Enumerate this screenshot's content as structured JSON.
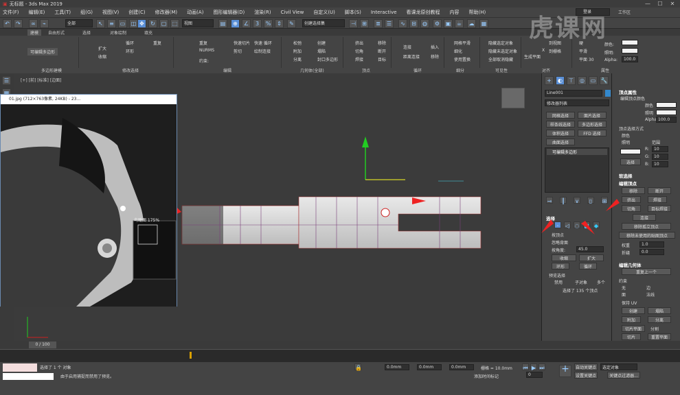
{
  "window": {
    "title": "无标题 - 3ds Max 2019",
    "min": "—",
    "max": "☐",
    "close": "✕"
  },
  "menus": [
    "文件(F)",
    "编辑(E)",
    "工具(T)",
    "组(G)",
    "视图(V)",
    "创建(C)",
    "修改器(M)",
    "动画(A)",
    "图形编辑器(D)",
    "渲染(R)",
    "Civil View",
    "自定义(U)",
    "脚本(S)",
    "Interactive",
    "看课龙原创教程",
    "内容",
    "帮助(H)"
  ],
  "account": {
    "login": "登录",
    "workspace": "工作区"
  },
  "toolbar": {
    "filter": "全部",
    "view": "视图",
    "selection_set": "创建选择集",
    "percent": "%"
  },
  "ribbon": {
    "tabs": [
      "建模",
      "自由形式",
      "选择",
      "对象绘制",
      "填充"
    ],
    "editable_poly": "可编辑多边形",
    "poly_modeling": "多边形建模",
    "modify_selection": "修改选择",
    "edit": "编辑",
    "geometry_all": "几何体(全部)",
    "vertices": "顶点",
    "loops": "循环",
    "subdivision": "细分",
    "visibility": "可见性",
    "align": "对齐",
    "properties": "属性",
    "grow": "扩大",
    "shrink": "收缩",
    "loop": "循环",
    "ring": "环形",
    "repeat": "重复",
    "quickslice": "快速切片",
    "quickloop": "快速 循环",
    "nurms": "NURMS",
    "cut": "剪切",
    "swiftloop": "绘制连接",
    "constraints": "约束:",
    "relax": "松弛",
    "create": "创建",
    "attach": "附加",
    "collapse": "塌陷",
    "detach": "分离",
    "cap": "封口多边形",
    "extrude": "挤出",
    "chamfer": "切角",
    "weld": "焊接",
    "remove": "移除",
    "break": "断开",
    "target": "目标",
    "connect": "连接",
    "dist_connect": "距离连接",
    "insert": "插入",
    "mesh_smooth": "网格平滑",
    "tessellate": "细化",
    "use_displacement": "使用置换",
    "hide_selected": "隐藏选定对象",
    "hide_unselected": "隐藏未选定对象",
    "unhide_all": "全部取消隐藏",
    "make_planar": "生成平面",
    "to_view": "到视图",
    "to_grid": "到栅格",
    "x": "X",
    "planar": "平面",
    "planar30": "平面 30",
    "hard": "硬",
    "smooth": "平滑",
    "color": "颜色:",
    "illum": "照明:",
    "alpha": "Alpha:",
    "alpha_val": "100.0"
  },
  "viewport": {
    "label": "[+] [前] [标准] [边面]",
    "frame": "0 / 100"
  },
  "image_window": {
    "title": "01.jpg (712×763像素, 24KB) - 23...",
    "thumb_label": "鸟瞰图 175%"
  },
  "command_panel": {
    "object_name": "Line001",
    "modifier_list": "修改器列表",
    "mod_buttons": [
      "网格选择",
      "面片选择",
      "样条线选择",
      "多边形选择",
      "体积选择",
      "FFD 选择",
      "曲面选择"
    ],
    "stack_item": "可编辑多边形",
    "selection": {
      "title": "选择",
      "by_vertex": "按顶点",
      "ignore_backfacing": "忽略背面",
      "by_angle": "按角度:",
      "angle": "45.0",
      "shrink": "收缩",
      "grow": "扩大",
      "ring": "环形",
      "loop": "循环",
      "preview": "预览选择",
      "disabled": "禁用",
      "subobject": "子对象",
      "multi": "多个",
      "status": "选择了 135 个顶点"
    }
  },
  "right_panel": {
    "vertex_props": "顶点属性",
    "edit_vertex_color": "编辑顶点颜色",
    "color": "颜色",
    "illum": "照明",
    "alpha": "Alpha",
    "alpha_val": "100.0",
    "select_by": "顶点选择方式",
    "color_opt": "颜色",
    "illum_opt": "照明",
    "range": "范围",
    "r": "R:",
    "g": "G:",
    "b": "B:",
    "v10": "10",
    "select": "选择",
    "soft_sel": "软选择",
    "edit_vertices": "编辑顶点",
    "remove": "移除",
    "break": "断开",
    "extrude": "挤出",
    "weld": "焊接",
    "chamfer": "切角",
    "target_weld": "目标焊接",
    "connect": "连接",
    "remove_isolated": "移除孤立顶点",
    "remove_unused": "移除未使用的贴图顶点",
    "weight": "权重",
    "crease": "折缝",
    "w_val": "1.0",
    "c_val": "0.0",
    "edit_geom": "编辑几何体",
    "repeat_last": "重复上一个",
    "constraints": "约束",
    "none": "无",
    "edge": "边",
    "face": "面",
    "normal": "法线",
    "preserve_uv": "保持 UV",
    "create": "创建",
    "collapse": "塌陷",
    "attach": "附加",
    "detach": "分离",
    "slice_plane": "切片平面",
    "split": "分割",
    "slice": "切片",
    "reset_plane": "重置平面"
  },
  "status": {
    "selected": "选择了 1 个 对象",
    "hint": "由于启用捕捉而禁用了预览。",
    "x": "0.0mm",
    "y": "0.0mm",
    "z": "0.0mm",
    "grid": "栅格 = 10.0mm",
    "auto_key": "自动关键点",
    "selected_obj": "选定对象",
    "set_key": "设置关键点",
    "key_filters": "关键点过滤器...",
    "add_time_tag": "添加时间标记",
    "frame": "0",
    "watermark": "虎课网"
  }
}
